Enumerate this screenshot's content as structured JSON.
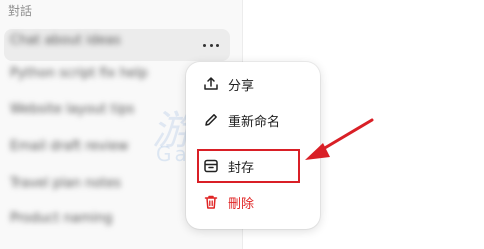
{
  "sidebar": {
    "section_label": "對話",
    "conversations": [
      {
        "label": "Chat about ideas",
        "active": true
      },
      {
        "label": "Python script fix help",
        "active": false
      },
      {
        "label": "Website layout tips",
        "active": false
      },
      {
        "label": "Email draft review",
        "active": false
      },
      {
        "label": "Travel plan notes",
        "active": false
      },
      {
        "label": "Product naming",
        "active": false
      }
    ],
    "more_icon": "more-horizontal-icon"
  },
  "context_menu": {
    "items": [
      {
        "label": "分享",
        "icon": "share-icon"
      },
      {
        "label": "重新命名",
        "icon": "pencil-icon"
      },
      {
        "label": "封存",
        "icon": "archive-icon",
        "highlighted": true
      },
      {
        "label": "刪除",
        "icon": "trash-icon",
        "danger": true
      }
    ]
  },
  "watermark": {
    "text_cn": "游戏机",
    "text_en": "GameLive.cx"
  },
  "colors": {
    "annotation": "#d91f26",
    "danger": "#e02424",
    "sidebar_bg": "#f9f9f9",
    "active_row": "#ececec"
  }
}
